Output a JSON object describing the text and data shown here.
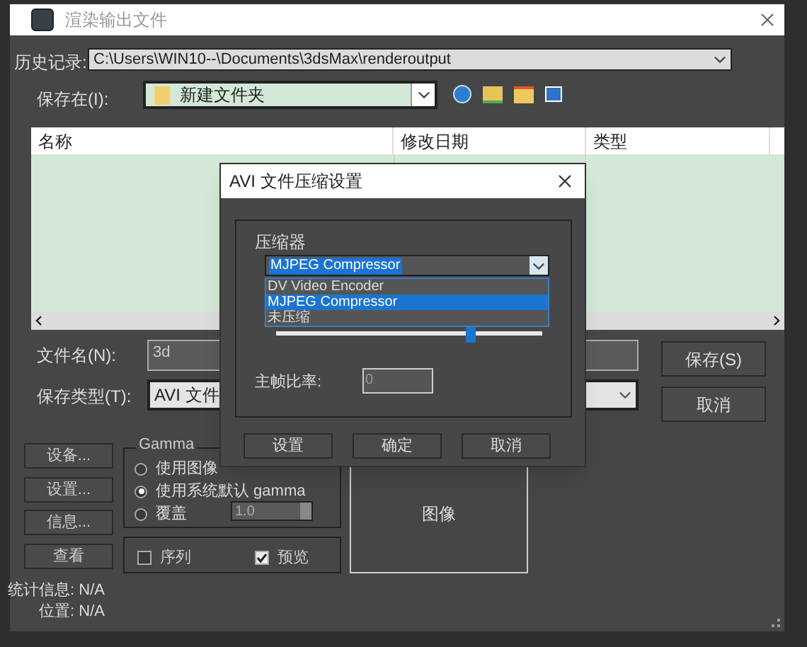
{
  "window": {
    "title": "渲染输出文件"
  },
  "history": {
    "label": "历史记录:",
    "value": "C:\\Users\\WIN10--\\Documents\\3dsMax\\renderoutput"
  },
  "save_in": {
    "label": "保存在(I):",
    "value": "新建文件夹"
  },
  "file_list": {
    "columns": [
      "名称",
      "修改日期",
      "类型"
    ]
  },
  "file_name": {
    "label": "文件名(N):",
    "value": "3d"
  },
  "file_type": {
    "label": "保存类型(T):",
    "value": "AVI 文件"
  },
  "actions": [
    "保存(S)",
    "取消"
  ],
  "side_buttons": [
    "设备...",
    "设置...",
    "信息...",
    "查看"
  ],
  "gamma": {
    "title": "Gamma",
    "options": [
      {
        "label": "使用图像",
        "selected": false
      },
      {
        "label": "使用系统默认 gamma",
        "selected": true
      },
      {
        "label": "覆盖",
        "selected": false
      }
    ],
    "override_value": "1.0"
  },
  "checks": [
    {
      "label": "序列",
      "checked": false
    },
    {
      "label": "预览",
      "checked": true
    }
  ],
  "image_label": "图像",
  "stats": [
    {
      "label": "统计信息:",
      "value": "N/A"
    },
    {
      "label": "位置:",
      "value": "N/A"
    }
  ],
  "avi_dialog": {
    "title": "AVI 文件压缩设置",
    "compressor_label": "压缩器",
    "compressor_value": "MJPEG Compressor",
    "options": [
      {
        "label": "DV Video Encoder",
        "selected": false
      },
      {
        "label": "MJPEG Compressor",
        "selected": true
      },
      {
        "label": "未压缩",
        "selected": false
      }
    ],
    "quality": {
      "level": 0.73
    },
    "keyframe_label": "主帧比率:",
    "keyframe_value": "0",
    "buttons": [
      "设置",
      "确定",
      "取消"
    ]
  }
}
